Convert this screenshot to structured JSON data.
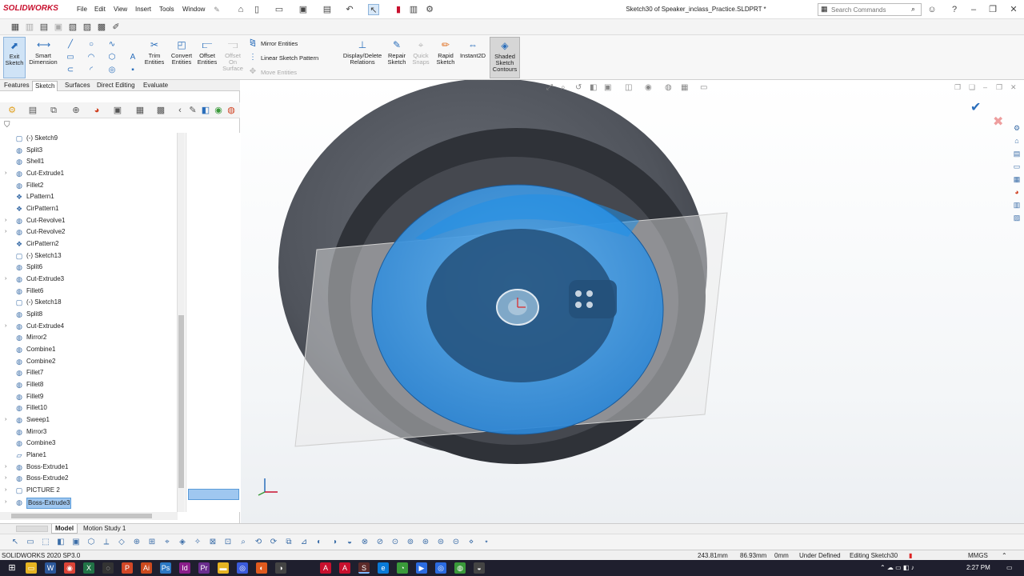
{
  "app": {
    "brand": "SOLIDWORKS",
    "doc_title": "Sketch30 of Speaker_inclass_Practice.SLDPRT *"
  },
  "menu": [
    "File",
    "Edit",
    "View",
    "Insert",
    "Tools",
    "Window"
  ],
  "search": {
    "placeholder": "Search Commands"
  },
  "commands": {
    "exit_sketch": "Exit Sketch",
    "smart_dimension": "Smart Dimension",
    "trim_entities": "Trim Entities",
    "convert_entities": "Convert Entities",
    "offset_entities": "Offset Entities",
    "offset_on_surface": "Offset On Surface",
    "mirror_entities": "Mirror Entities",
    "linear_sketch_pattern": "Linear Sketch Pattern",
    "move_entities": "Move Entities",
    "display_delete_relations": "Display/Delete Relations",
    "repair_sketch": "Repair Sketch",
    "quick_snaps": "Quick Snaps",
    "rapid_sketch": "Rapid Sketch",
    "instant2d": "Instant2D",
    "shaded_sketch_contours": "Shaded Sketch Contours"
  },
  "tabs": [
    "Features",
    "Sketch",
    "Surfaces",
    "Direct Editing",
    "Evaluate"
  ],
  "active_tab": "Sketch",
  "tree": [
    {
      "label": "(-) Sketch9",
      "icon": "sketch-icon",
      "expand": false
    },
    {
      "label": "Split3",
      "icon": "feature-icon",
      "expand": false
    },
    {
      "label": "Shell1",
      "icon": "feature-icon",
      "expand": false
    },
    {
      "label": "Cut-Extrude1",
      "icon": "feature-icon",
      "expand": true
    },
    {
      "label": "Fillet2",
      "icon": "feature-icon",
      "expand": false
    },
    {
      "label": "LPattern1",
      "icon": "pattern-icon",
      "expand": false
    },
    {
      "label": "CirPattern1",
      "icon": "pattern-icon",
      "expand": false
    },
    {
      "label": "Cut-Revolve1",
      "icon": "feature-icon",
      "expand": true
    },
    {
      "label": "Cut-Revolve2",
      "icon": "feature-icon",
      "expand": true
    },
    {
      "label": "CirPattern2",
      "icon": "pattern-icon",
      "expand": false
    },
    {
      "label": "(-) Sketch13",
      "icon": "sketch-icon",
      "expand": false
    },
    {
      "label": "Split6",
      "icon": "feature-icon",
      "expand": false
    },
    {
      "label": "Cut-Extrude3",
      "icon": "feature-icon",
      "expand": true
    },
    {
      "label": "Fillet6",
      "icon": "feature-icon",
      "expand": false
    },
    {
      "label": "(-) Sketch18",
      "icon": "sketch-icon",
      "expand": false
    },
    {
      "label": "Split8",
      "icon": "feature-icon",
      "expand": false
    },
    {
      "label": "Cut-Extrude4",
      "icon": "feature-icon",
      "expand": true
    },
    {
      "label": "Mirror2",
      "icon": "feature-icon",
      "expand": false
    },
    {
      "label": "Combine1",
      "icon": "feature-icon",
      "expand": false
    },
    {
      "label": "Combine2",
      "icon": "feature-icon",
      "expand": false
    },
    {
      "label": "Fillet7",
      "icon": "feature-icon",
      "expand": false
    },
    {
      "label": "Fillet8",
      "icon": "feature-icon",
      "expand": false
    },
    {
      "label": "Fillet9",
      "icon": "feature-icon",
      "expand": false
    },
    {
      "label": "Fillet10",
      "icon": "feature-icon",
      "expand": false
    },
    {
      "label": "Sweep1",
      "icon": "feature-icon",
      "expand": true
    },
    {
      "label": "Mirror3",
      "icon": "feature-icon",
      "expand": false
    },
    {
      "label": "Combine3",
      "icon": "feature-icon",
      "expand": false
    },
    {
      "label": "Plane1",
      "icon": "plane-icon",
      "expand": false
    },
    {
      "label": "Boss-Extrude1",
      "icon": "feature-icon",
      "expand": true
    },
    {
      "label": "Boss-Extrude2",
      "icon": "feature-icon",
      "expand": true
    },
    {
      "label": "PICTURE 2",
      "icon": "sketch-icon",
      "expand": true
    },
    {
      "label": "Boss-Extrude3",
      "icon": "feature-icon",
      "expand": true,
      "selected": true
    }
  ],
  "bottom_tabs": [
    "Model",
    "Motion Study 1"
  ],
  "status": {
    "version": "SOLIDWORKS 2020 SP3.0",
    "x": "243.81mm",
    "y": "86.93mm",
    "z": "0mm",
    "state": "Under Defined",
    "editing": "Editing Sketch30",
    "units": "MMGS"
  },
  "taskbar": {
    "time": "2:27 PM"
  },
  "colors": {
    "accent": "#2a6ebb",
    "face": "#2f8fd9",
    "body": "#5a5e66"
  }
}
